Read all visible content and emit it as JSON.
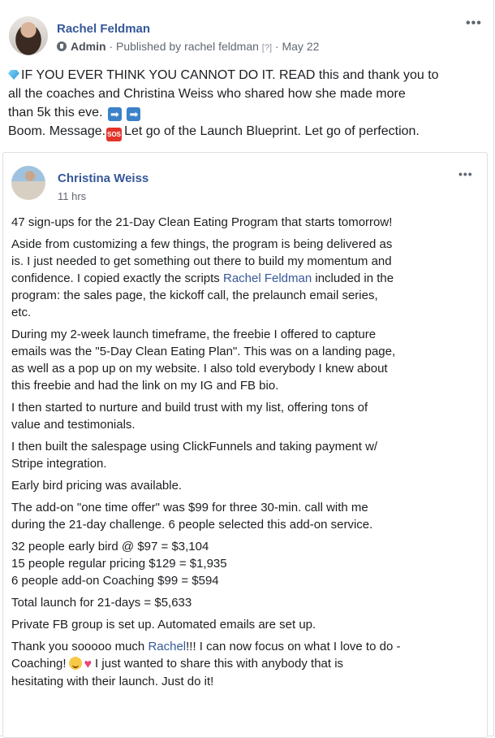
{
  "post": {
    "author": "Rachel Feldman",
    "role": "Admin",
    "published_by": "Published by rachel feldman",
    "help_marker": "[?]",
    "date": "May 22",
    "text_lines": [
      "IF YOU EVER THINK YOU CANNOT DO IT. READ this and thank you to",
      "all the coaches and Christina Weiss who shared how she made more",
      "than 5k this eve.",
      "Boom. Message.",
      "Let go of the Launch Blueprint. Let go of perfection."
    ],
    "emoji": {
      "gem": "gem-icon",
      "arrow_1": "➡",
      "arrow_2": "➡",
      "sos": "SOS"
    }
  },
  "shared": {
    "author": "Christina Weiss",
    "time": "11 hrs",
    "paragraphs": {
      "p1": [
        "47 sign-ups for the 21-Day Clean Eating Program that starts tomorrow!"
      ],
      "p2": [
        "Aside from customizing a few things, the program is being delivered as",
        "is. I just needed to get something out there to build my momentum and",
        "confidence. I copied exactly the scripts ",
        "Rachel Feldman",
        " included in the",
        "program: the sales page, the kickoff call, the prelaunch email series,",
        "etc."
      ],
      "p3": [
        "During my 2-week launch timeframe, the freebie I offered to capture",
        "emails was the \"5-Day Clean Eating Plan\". This was on a landing page,",
        "as well as a pop up on my website. I also told everybody I knew about",
        "this freebie and had the link on my IG and FB bio."
      ],
      "p4": [
        "I then started to nurture and build trust with my list, offering tons of",
        "value and testimonials."
      ],
      "p5": [
        "I then built the salespage using ClickFunnels and taking payment w/",
        "Stripe integration."
      ],
      "p6": [
        "Early bird pricing was available."
      ],
      "p7": [
        "The add-on \"one time offer\" was $99 for three 30-min. call with me",
        "during the 21-day challenge. 6 people selected this add-on service."
      ],
      "p8": [
        "32 people early bird @ $97 = $3,104",
        "15 people regular pricing $129 = $1,935",
        "6 people add-on Coaching $99 = $594"
      ],
      "p9": [
        "Total launch for 21-days = $5,633"
      ],
      "p10": [
        "Private FB group is set up. Automated emails are set up."
      ],
      "p11": [
        "Thank you sooooo much ",
        "Rachel",
        "!!! I can now focus on what I love to do -",
        "Coaching!",
        "I just wanted to share this with anybody that is",
        "hesitating with their launch. Just do it!"
      ]
    },
    "emoji": {
      "smile": "smile-icon",
      "heart": "♥"
    }
  },
  "more_icon": "•••"
}
